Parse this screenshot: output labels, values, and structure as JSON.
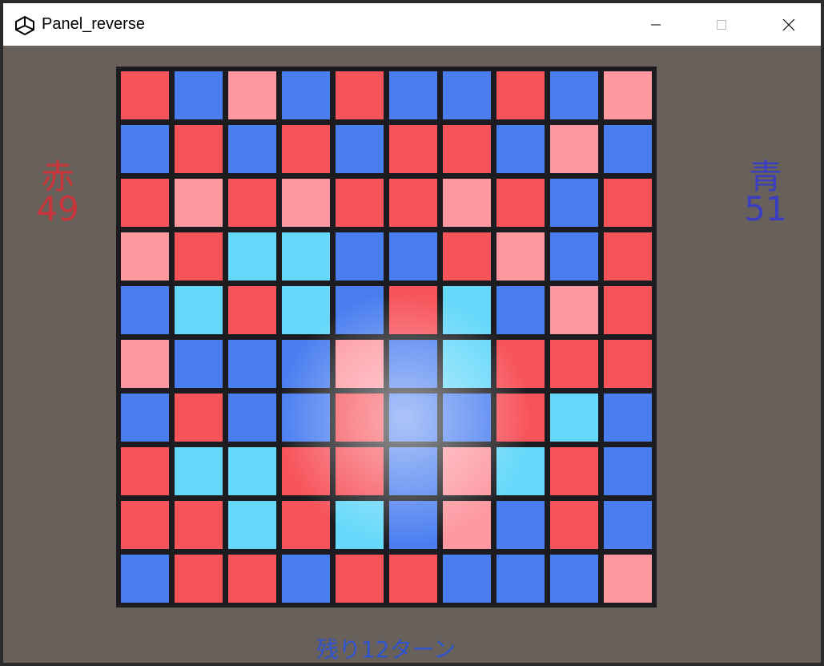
{
  "window": {
    "title": "Panel_reverse",
    "icon": "unity-icon",
    "controls": [
      "minimize-icon",
      "maximize-icon",
      "close-icon"
    ]
  },
  "game": {
    "red_label": "赤",
    "red_score": "49",
    "blue_label": "青",
    "blue_score": "51",
    "turns_remaining": "残り12ターン"
  },
  "colors": {
    "background": "#68605a",
    "grid": "#1c1c20",
    "red_score_text": "#c8333a",
    "blue_score_text": "#3c3ec0",
    "turn_text": "#2f54d0",
    "R": "#f7535b",
    "r": "#fd97a0",
    "B": "#4a7ef0",
    "c": "#66d8fa"
  },
  "board": {
    "rows": 10,
    "cols": 10,
    "legend": {
      "R": "red",
      "r": "light-red",
      "B": "blue",
      "c": "cyan"
    },
    "cells": [
      [
        "R",
        "B",
        "r",
        "B",
        "R",
        "B",
        "B",
        "R",
        "B",
        "r"
      ],
      [
        "B",
        "R",
        "B",
        "R",
        "B",
        "R",
        "R",
        "B",
        "r",
        "B"
      ],
      [
        "R",
        "r",
        "R",
        "r",
        "R",
        "R",
        "r",
        "R",
        "B",
        "R"
      ],
      [
        "r",
        "R",
        "c",
        "c",
        "B",
        "B",
        "R",
        "r",
        "B",
        "R"
      ],
      [
        "B",
        "c",
        "R",
        "c",
        "B",
        "R",
        "c",
        "B",
        "r",
        "R"
      ],
      [
        "r",
        "B",
        "B",
        "B",
        "r",
        "B",
        "c",
        "R",
        "R",
        "R"
      ],
      [
        "B",
        "R",
        "B",
        "B",
        "R",
        "B",
        "B",
        "R",
        "c",
        "B"
      ],
      [
        "R",
        "c",
        "c",
        "R",
        "R",
        "B",
        "r",
        "c",
        "R",
        "B"
      ],
      [
        "R",
        "R",
        "c",
        "R",
        "c",
        "B",
        "r",
        "B",
        "R",
        "B"
      ],
      [
        "B",
        "R",
        "R",
        "B",
        "R",
        "R",
        "B",
        "B",
        "B",
        "r"
      ]
    ]
  }
}
